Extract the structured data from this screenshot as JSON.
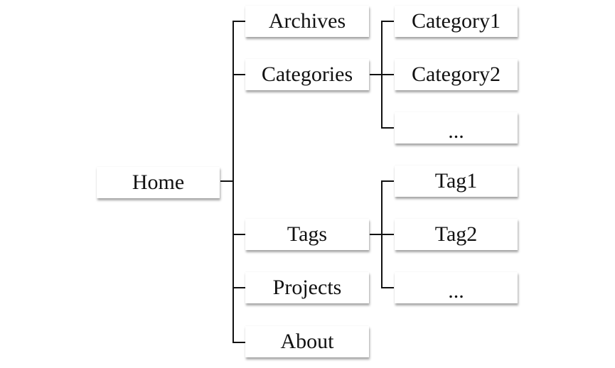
{
  "diagram": {
    "root": {
      "label": "Home"
    },
    "level1": [
      {
        "label": "Archives"
      },
      {
        "label": "Categories"
      },
      {
        "label": "Tags"
      },
      {
        "label": "Projects"
      },
      {
        "label": "About"
      }
    ],
    "categories_children": [
      {
        "label": "Category1"
      },
      {
        "label": "Category2"
      },
      {
        "label": "..."
      }
    ],
    "tags_children": [
      {
        "label": "Tag1"
      },
      {
        "label": "Tag2"
      },
      {
        "label": "..."
      }
    ],
    "edges": [
      [
        "Home",
        "Archives"
      ],
      [
        "Home",
        "Categories"
      ],
      [
        "Home",
        "Tags"
      ],
      [
        "Home",
        "Projects"
      ],
      [
        "Home",
        "About"
      ],
      [
        "Categories",
        "Category1"
      ],
      [
        "Categories",
        "Category2"
      ],
      [
        "Categories",
        "..."
      ],
      [
        "Tags",
        "Tag1"
      ],
      [
        "Tags",
        "Tag2"
      ],
      [
        "Tags",
        "..."
      ]
    ]
  }
}
